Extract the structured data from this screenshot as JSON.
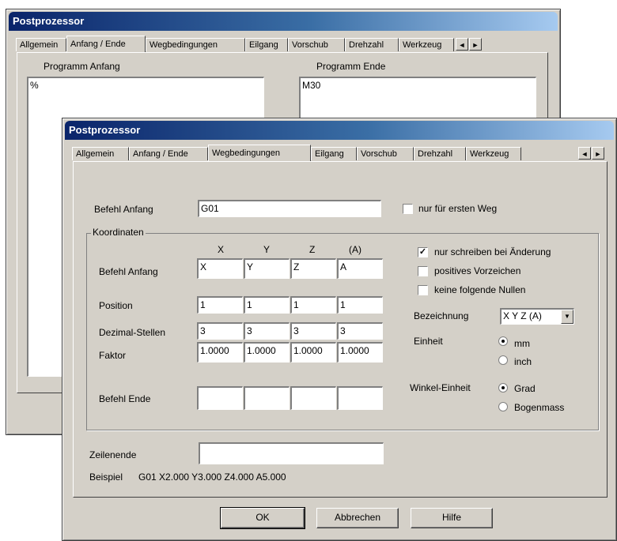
{
  "back_window": {
    "title": "Postprozessor",
    "tabs": [
      "Allgemein",
      "Anfang / Ende",
      "Wegbedingungen",
      "Eilgang",
      "Vorschub",
      "Drehzahl",
      "Werkzeug"
    ],
    "program_start_label": "Programm Anfang",
    "program_start_value": "%",
    "program_end_label": "Programm Ende",
    "program_end_value": "M30",
    "scroll_left": "◄",
    "scroll_right": "►"
  },
  "front_window": {
    "title": "Postprozessor",
    "tabs": [
      "Allgemein",
      "Anfang / Ende",
      "Wegbedingungen",
      "Eilgang",
      "Vorschub",
      "Drehzahl",
      "Werkzeug"
    ],
    "active_tab": "Wegbedingungen",
    "scroll_left": "◄",
    "scroll_right": "►",
    "command_start_label": "Befehl Anfang",
    "command_start_value": "G01",
    "first_path_only_label": "nur für ersten Weg",
    "first_path_only_checked": false,
    "coords_group_label": "Koordinaten",
    "axis_headers": [
      "X",
      "Y",
      "Z",
      "(A)"
    ],
    "rows": {
      "befehl_anfang": {
        "label": "Befehl Anfang",
        "values": [
          "X",
          "Y",
          "Z",
          "A"
        ]
      },
      "position": {
        "label": "Position",
        "values": [
          "1",
          "1",
          "1",
          "1"
        ]
      },
      "dezimal": {
        "label": "Dezimal-Stellen",
        "values": [
          "3",
          "3",
          "3",
          "3"
        ]
      },
      "faktor": {
        "label": "Faktor",
        "values": [
          "1.0000",
          "1.0000",
          "1.0000",
          "1.0000"
        ]
      },
      "befehl_ende": {
        "label": "Befehl Ende",
        "values": [
          "",
          "",
          "",
          ""
        ]
      }
    },
    "options": {
      "write_on_change": {
        "label": "nur schreiben bei Änderung",
        "checked": true,
        "mark": "✓"
      },
      "positive_sign": {
        "label": "positives Vorzeichen",
        "checked": false
      },
      "no_trailing_zeros": {
        "label": "keine folgende Nullen",
        "checked": false
      }
    },
    "designation_label": "Bezeichnung",
    "designation_value": "X Y Z (A)",
    "unit_label": "Einheit",
    "unit_options": [
      "mm",
      "inch"
    ],
    "unit_selected": "mm",
    "angle_unit_label": "Winkel-Einheit",
    "angle_unit_options": [
      "Grad",
      "Bogenmass"
    ],
    "angle_unit_selected": "Grad",
    "line_end_label": "Zeilenende",
    "line_end_value": "",
    "example_label": "Beispiel",
    "example_value": "G01 X2.000 Y3.000 Z4.000 A5.000",
    "ok_label": "OK",
    "cancel_label": "Abbrechen",
    "help_label": "Hilfe"
  }
}
